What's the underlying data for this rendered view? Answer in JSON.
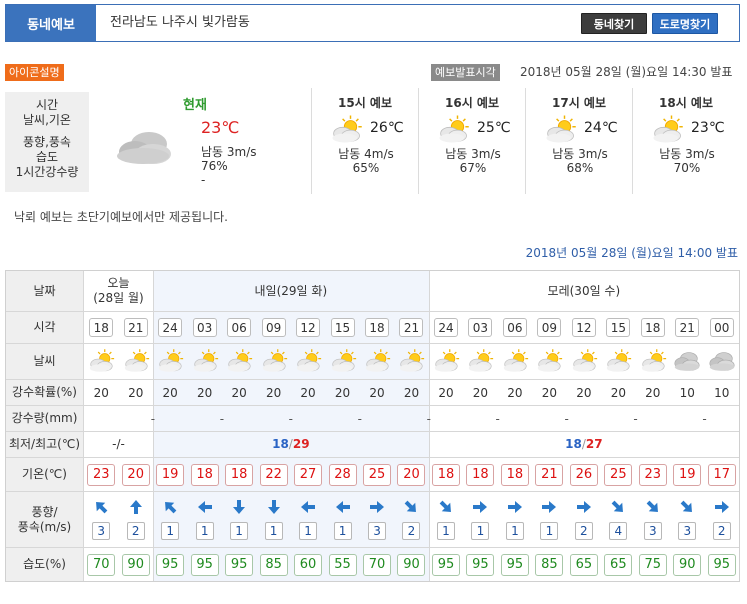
{
  "header": {
    "tab": "동네예보",
    "location": "전라남도 나주시 빛가람동",
    "btn_area": "동네찾기",
    "btn_road": "도로명찾기"
  },
  "info": {
    "icon_help": "아이콘설명",
    "pub_label": "예보발표시각",
    "pub_time": "2018년 05월 28일 (월)요일 14:30 발표"
  },
  "legend": {
    "line1": "시간",
    "line2": "날씨,기온",
    "line3": "풍향,풍속",
    "line4": "습도",
    "line5": "1시간강수량"
  },
  "current": {
    "title": "현재",
    "temp": "23℃",
    "wind": "남동 3m/s",
    "humidity": "76%",
    "rain": "-",
    "icon": "cloudy-icon"
  },
  "forecasts": [
    {
      "title": "15시 예보",
      "temp": "26℃",
      "wind": "남동 4m/s",
      "humidity": "65%",
      "icon": "partly-cloudy-icon"
    },
    {
      "title": "16시 예보",
      "temp": "25℃",
      "wind": "남동 3m/s",
      "humidity": "67%",
      "icon": "partly-cloudy-icon"
    },
    {
      "title": "17시 예보",
      "temp": "24℃",
      "wind": "남동 3m/s",
      "humidity": "68%",
      "icon": "partly-cloudy-icon"
    },
    {
      "title": "18시 예보",
      "temp": "23℃",
      "wind": "남동 3m/s",
      "humidity": "70%",
      "icon": "partly-cloudy-icon"
    }
  ],
  "notice": "낙뢰 예보는 초단기예보에서만 제공됩니다.",
  "issued": "2018년 05월 28일 (월)요일 14:00 발표",
  "table": {
    "labels": {
      "date": "날짜",
      "time": "시각",
      "weather": "날씨",
      "rain_prob": "강수확률(%)",
      "rain_amt": "강수량(mm)",
      "minmax": "최저/최고(℃)",
      "temp": "기온(℃)",
      "wind": "풍향/\n풍속(m/s)",
      "humidity": "습도(%)"
    },
    "days": [
      {
        "label": "오늘\n(28일 월)",
        "minmax": "-/-",
        "min": "",
        "max": ""
      },
      {
        "label": "내일(29일 화)",
        "minmax": "",
        "min": "18",
        "max": "29"
      },
      {
        "label": "모레(30일 수)",
        "minmax": "",
        "min": "18",
        "max": "27"
      }
    ],
    "hours": [
      "18",
      "21",
      "24",
      "03",
      "06",
      "09",
      "12",
      "15",
      "18",
      "21",
      "24",
      "03",
      "06",
      "09",
      "12",
      "15",
      "18",
      "21",
      "00"
    ],
    "weather": [
      "partly-cloudy-icon",
      "partly-cloudy-icon",
      "partly-cloudy-icon",
      "partly-cloudy-icon",
      "partly-cloudy-icon",
      "partly-cloudy-icon",
      "partly-cloudy-icon",
      "partly-cloudy-icon",
      "partly-cloudy-icon",
      "partly-cloudy-icon",
      "partly-cloudy-icon",
      "partly-cloudy-icon",
      "partly-cloudy-icon",
      "partly-cloudy-icon",
      "partly-cloudy-icon",
      "partly-cloudy-icon",
      "partly-cloudy-icon",
      "cloudy-icon",
      "cloudy-icon"
    ],
    "rain_prob": [
      "20",
      "20",
      "20",
      "20",
      "20",
      "20",
      "20",
      "20",
      "20",
      "20",
      "20",
      "20",
      "20",
      "20",
      "20",
      "20",
      "20",
      "10",
      "10"
    ],
    "rain_amt": [
      "-",
      "-",
      "-",
      "-",
      "-",
      "-",
      "-",
      "-",
      "-"
    ],
    "temps": [
      "23",
      "20",
      "19",
      "18",
      "18",
      "22",
      "27",
      "28",
      "25",
      "20",
      "18",
      "18",
      "18",
      "21",
      "26",
      "25",
      "23",
      "19",
      "17"
    ],
    "wind_dir": [
      "nw",
      "n",
      "nw",
      "w",
      "s",
      "s",
      "w",
      "w",
      "e",
      "se",
      "se",
      "e",
      "e",
      "e",
      "e",
      "se",
      "se",
      "se",
      "e"
    ],
    "wind_speed": [
      "3",
      "2",
      "1",
      "1",
      "1",
      "1",
      "1",
      "1",
      "3",
      "2",
      "1",
      "1",
      "1",
      "1",
      "2",
      "4",
      "3",
      "3",
      "2"
    ],
    "humidity": [
      "70",
      "90",
      "95",
      "95",
      "95",
      "85",
      "60",
      "55",
      "70",
      "90",
      "95",
      "95",
      "95",
      "85",
      "65",
      "65",
      "75",
      "90",
      "95"
    ]
  },
  "colors": {
    "brand_blue": "#3b73bd",
    "temp_red": "#d11111",
    "humidity_green": "#1f8a1f",
    "title_green": "#2f9b2f"
  }
}
